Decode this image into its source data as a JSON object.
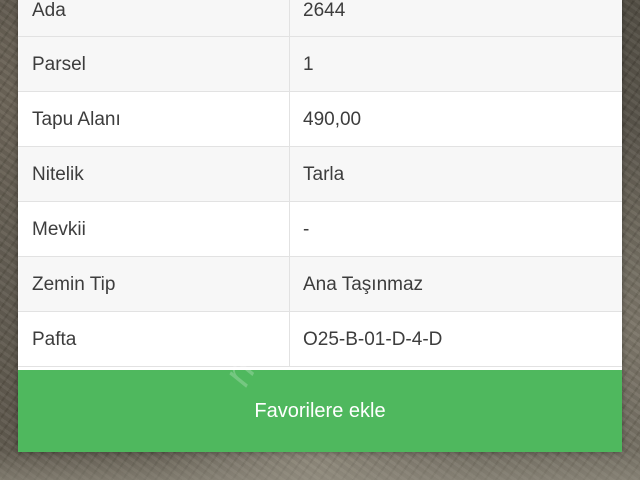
{
  "property_details": {
    "rows": [
      {
        "label": "Ada",
        "value": "2644"
      },
      {
        "label": "Parsel",
        "value": "1"
      },
      {
        "label": "Tapu Alanı",
        "value": "490,00"
      },
      {
        "label": "Nitelik",
        "value": "Tarla"
      },
      {
        "label": "Mevkii",
        "value": "-"
      },
      {
        "label": "Zemin Tip",
        "value": "Ana Taşınmaz"
      },
      {
        "label": "Pafta",
        "value": "O25-B-01-D-4-D"
      }
    ]
  },
  "actions": {
    "favorite_label": "Favorilere ekle"
  },
  "watermark_text": "nen"
}
